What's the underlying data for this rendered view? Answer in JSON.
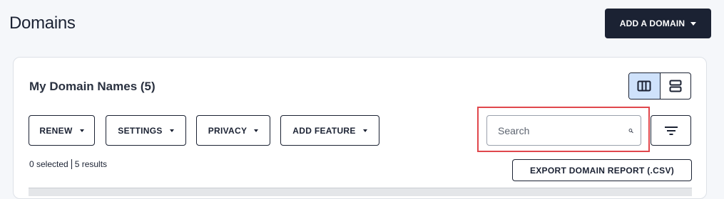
{
  "header": {
    "title": "Domains",
    "add_domain_label": "ADD A DOMAIN"
  },
  "card": {
    "title": "My Domain Names (5)",
    "view_toggle": {
      "options": [
        {
          "icon": "columns-icon",
          "active": true
        },
        {
          "icon": "rows-icon",
          "active": false
        }
      ]
    },
    "actions": [
      {
        "label": "RENEW"
      },
      {
        "label": "SETTINGS"
      },
      {
        "label": "PRIVACY"
      },
      {
        "label": "ADD FEATURE"
      }
    ],
    "search": {
      "placeholder": "Search",
      "value": "",
      "icon": "search-icon"
    },
    "filter_icon": "filter-icon",
    "selected_text": "0 selected",
    "results_text": "5 results",
    "export_label": "EXPORT DOMAIN REPORT (.CSV)"
  },
  "colors": {
    "primary": "#1b2233",
    "highlight": "#e0474c",
    "toggle_active": "#cfe2fb",
    "page_bg": "#f5f7fa"
  }
}
